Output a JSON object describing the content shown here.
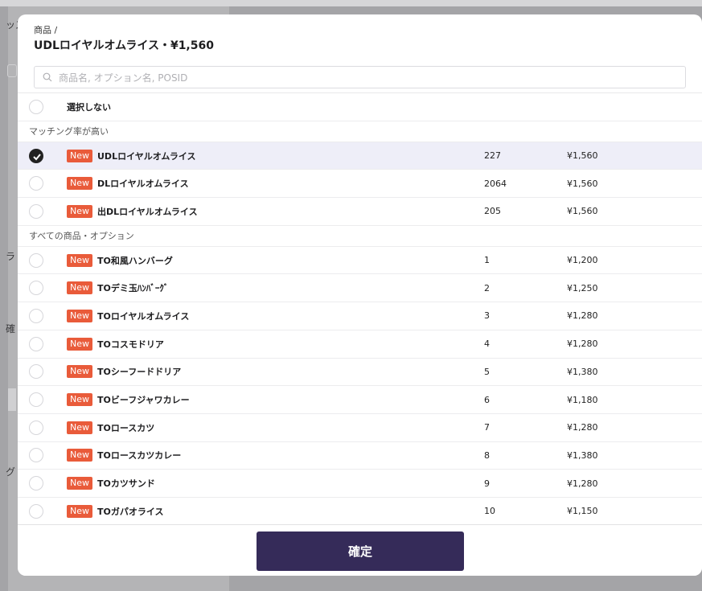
{
  "background": {
    "side_chars": [
      "ッズ",
      "ラ",
      "確",
      "グ"
    ]
  },
  "modal": {
    "breadcrumb": "商品 /",
    "title": "UDLロイヤルオムライス・¥1,560",
    "search": {
      "placeholder": "商品名, オプション名, POSID"
    },
    "none_option": "選択しない",
    "sections": {
      "high_match": "マッチング率が高い",
      "all": "すべての商品・オプション"
    },
    "badge_label": "New",
    "high_match_items": [
      {
        "name": "UDLロイヤルオムライス",
        "code": "227",
        "price": "¥1,560",
        "selected": true
      },
      {
        "name": "DLロイヤルオムライス",
        "code": "2064",
        "price": "¥1,560",
        "selected": false
      },
      {
        "name": "出DLロイヤルオムライス",
        "code": "205",
        "price": "¥1,560",
        "selected": false
      }
    ],
    "all_items": [
      {
        "name": "TO和風ハンバーグ",
        "code": "1",
        "price": "¥1,200"
      },
      {
        "name": "TOデミ玉ﾊﾝﾊﾞｰｸﾞ",
        "code": "2",
        "price": "¥1,250"
      },
      {
        "name": "TOロイヤルオムライス",
        "code": "3",
        "price": "¥1,280"
      },
      {
        "name": "TOコスモドリア",
        "code": "4",
        "price": "¥1,280"
      },
      {
        "name": "TOシーフードドリア",
        "code": "5",
        "price": "¥1,380"
      },
      {
        "name": "TOビーフジャワカレー",
        "code": "6",
        "price": "¥1,180"
      },
      {
        "name": "TOロースカツ",
        "code": "7",
        "price": "¥1,280"
      },
      {
        "name": "TOロースカツカレー",
        "code": "8",
        "price": "¥1,380"
      },
      {
        "name": "TOカツサンド",
        "code": "9",
        "price": "¥1,280"
      },
      {
        "name": "TOガパオライス",
        "code": "10",
        "price": "¥1,150"
      }
    ],
    "confirm_label": "確定"
  },
  "colors": {
    "badge": "#e95b3a",
    "confirm_button": "#352b59",
    "selected_row": "#eeeef8"
  }
}
